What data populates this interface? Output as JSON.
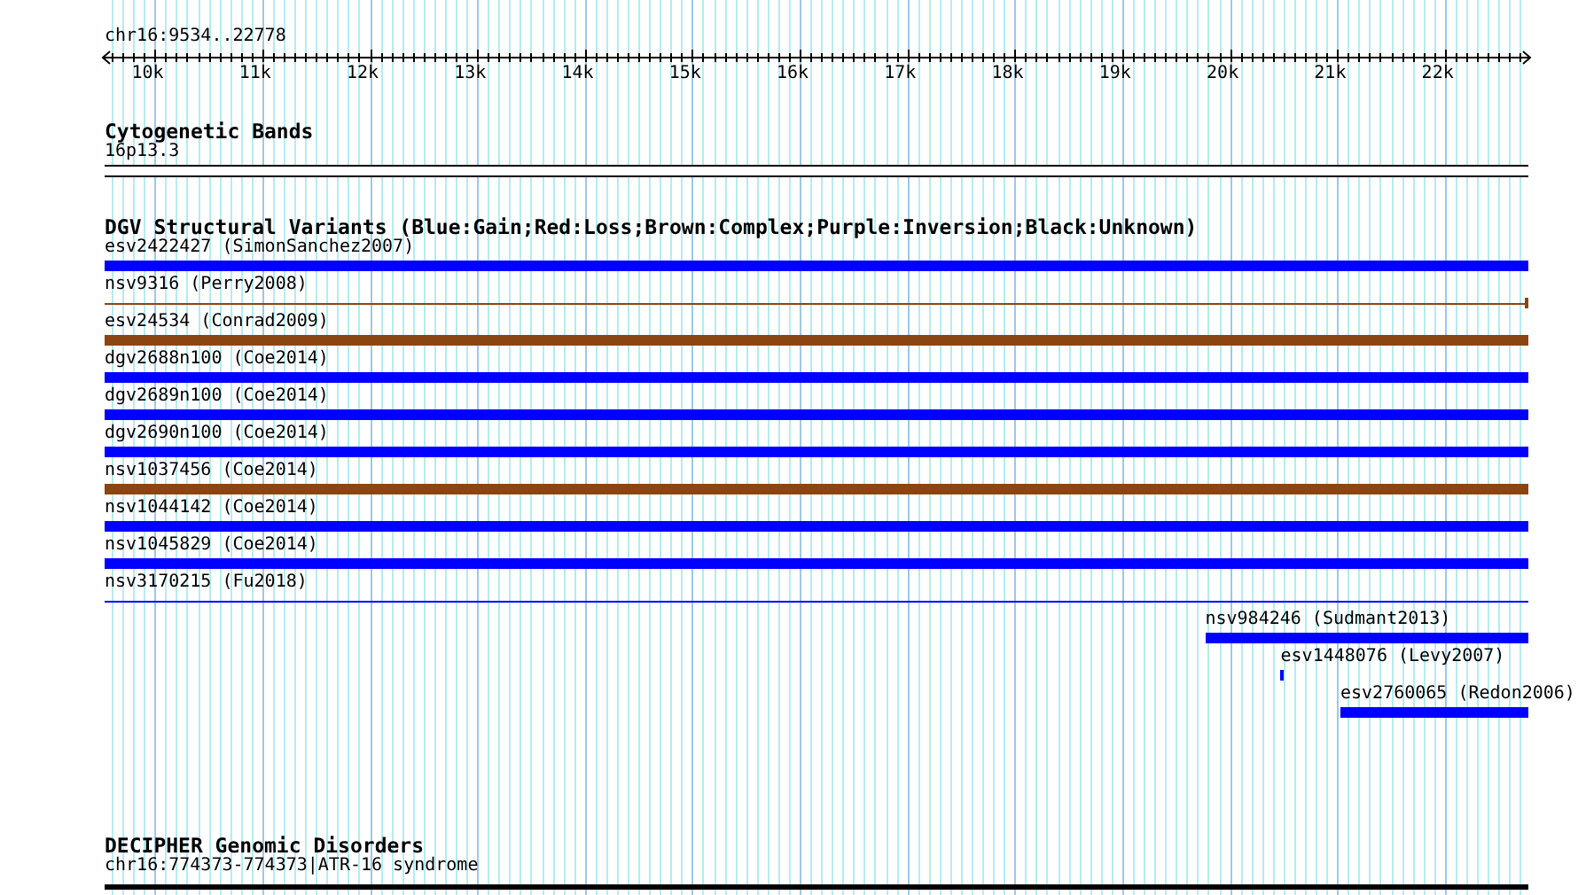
{
  "ruler": {
    "location": "chr16:9534..22778",
    "ticks": [
      "10k",
      "11k",
      "12k",
      "13k",
      "14k",
      "15k",
      "16k",
      "17k",
      "18k",
      "19k",
      "20k",
      "21k",
      "22k"
    ]
  },
  "tracks": [
    {
      "kind": "bands",
      "title": "Cytogenetic Bands",
      "features": [
        {
          "label": "16p13.3",
          "kind": "band",
          "color": "#ffffff"
        }
      ]
    },
    {
      "kind": "variants",
      "title": "DGV Structural Variants (Blue:Gain;Red:Loss;Brown:Complex;Purple:Inversion;Black:Unknown)",
      "features": [
        {
          "label": "esv2422427 (SimonSanchez2007)",
          "kind": "bar",
          "color": "#0000ff"
        },
        {
          "label": "nsv9316 (Perry2008)",
          "kind": "line",
          "color": "#8b4513",
          "end_tick": true
        },
        {
          "label": "esv24534 (Conrad2009)",
          "kind": "bar",
          "color": "#8b4513"
        },
        {
          "label": "dgv2688n100 (Coe2014)",
          "kind": "bar",
          "color": "#0000ff"
        },
        {
          "label": "dgv2689n100 (Coe2014)",
          "kind": "bar",
          "color": "#0000ff"
        },
        {
          "label": "dgv2690n100 (Coe2014)",
          "kind": "bar",
          "color": "#0000ff"
        },
        {
          "label": "nsv1037456 (Coe2014)",
          "kind": "bar",
          "color": "#8b4513"
        },
        {
          "label": "nsv1044142 (Coe2014)",
          "kind": "bar",
          "color": "#0000ff"
        },
        {
          "label": "nsv1045829 (Coe2014)",
          "kind": "bar",
          "color": "#0000ff"
        },
        {
          "label": "nsv3170215 (Fu2018)",
          "kind": "line",
          "color": "#0000ff",
          "end_tick": false
        },
        {
          "label": "nsv984246 (Sudmant2013)",
          "kind": "bar",
          "color": "#0000ff"
        },
        {
          "label": "esv1448076 (Levy2007)",
          "kind": "bar",
          "color": "#0000ff"
        },
        {
          "label": "esv2760065 (Redon2006)",
          "kind": "bar",
          "color": "#0000ff"
        }
      ]
    },
    {
      "kind": "decipher",
      "title": "DECIPHER Genomic Disorders",
      "features": [
        {
          "label": "chr16:774373-774373|ATR-16 syndrome",
          "kind": "bar",
          "color": "#000000"
        }
      ]
    }
  ]
}
